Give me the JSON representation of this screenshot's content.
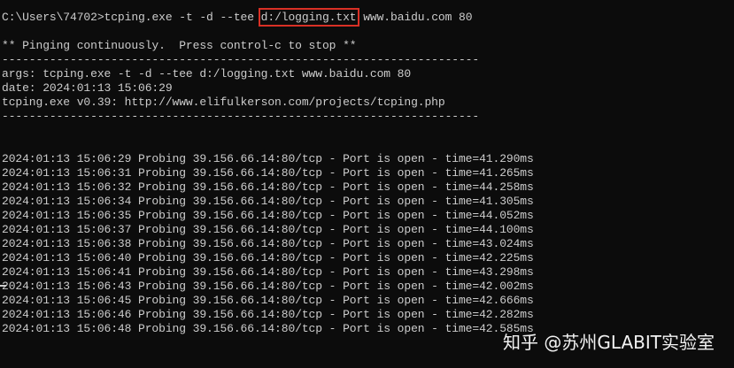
{
  "terminal": {
    "prompt": "C:\\Users\\74702>",
    "command_prefix": "tcping.exe -t -d --tee ",
    "command_highlight": "d:/logging.txt",
    "command_suffix": " www.baidu.com 80",
    "pinging_msg": "** Pinging continuously.  Press control-c to stop **",
    "separator": "----------------------------------------------------------------------",
    "args": "args: tcping.exe -t -d --tee d:/logging.txt www.baidu.com 80",
    "date": "date: 2024:01:13 15:06:29",
    "version": "tcping.exe v0.39: http://www.elifulkerson.com/projects/tcping.php",
    "probes": [
      "2024:01:13 15:06:29 Probing 39.156.66.14:80/tcp - Port is open - time=41.290ms",
      "2024:01:13 15:06:31 Probing 39.156.66.14:80/tcp - Port is open - time=41.265ms",
      "2024:01:13 15:06:32 Probing 39.156.66.14:80/tcp - Port is open - time=44.258ms",
      "2024:01:13 15:06:34 Probing 39.156.66.14:80/tcp - Port is open - time=41.305ms",
      "2024:01:13 15:06:35 Probing 39.156.66.14:80/tcp - Port is open - time=44.052ms",
      "2024:01:13 15:06:37 Probing 39.156.66.14:80/tcp - Port is open - time=44.100ms",
      "2024:01:13 15:06:38 Probing 39.156.66.14:80/tcp - Port is open - time=43.024ms",
      "2024:01:13 15:06:40 Probing 39.156.66.14:80/tcp - Port is open - time=42.225ms",
      "2024:01:13 15:06:41 Probing 39.156.66.14:80/tcp - Port is open - time=43.298ms",
      "2024:01:13 15:06:43 Probing 39.156.66.14:80/tcp - Port is open - time=42.002ms",
      "2024:01:13 15:06:45 Probing 39.156.66.14:80/tcp - Port is open - time=42.666ms",
      "2024:01:13 15:06:46 Probing 39.156.66.14:80/tcp - Port is open - time=42.282ms",
      "2024:01:13 15:06:48 Probing 39.156.66.14:80/tcp - Port is open - time=42.585ms"
    ]
  },
  "watermark": "知乎 @苏州GLABIT实验室",
  "colors": {
    "background": "#0c0c0c",
    "text": "#cccccc",
    "highlight_box": "#d93025",
    "watermark": "#ffffff"
  }
}
